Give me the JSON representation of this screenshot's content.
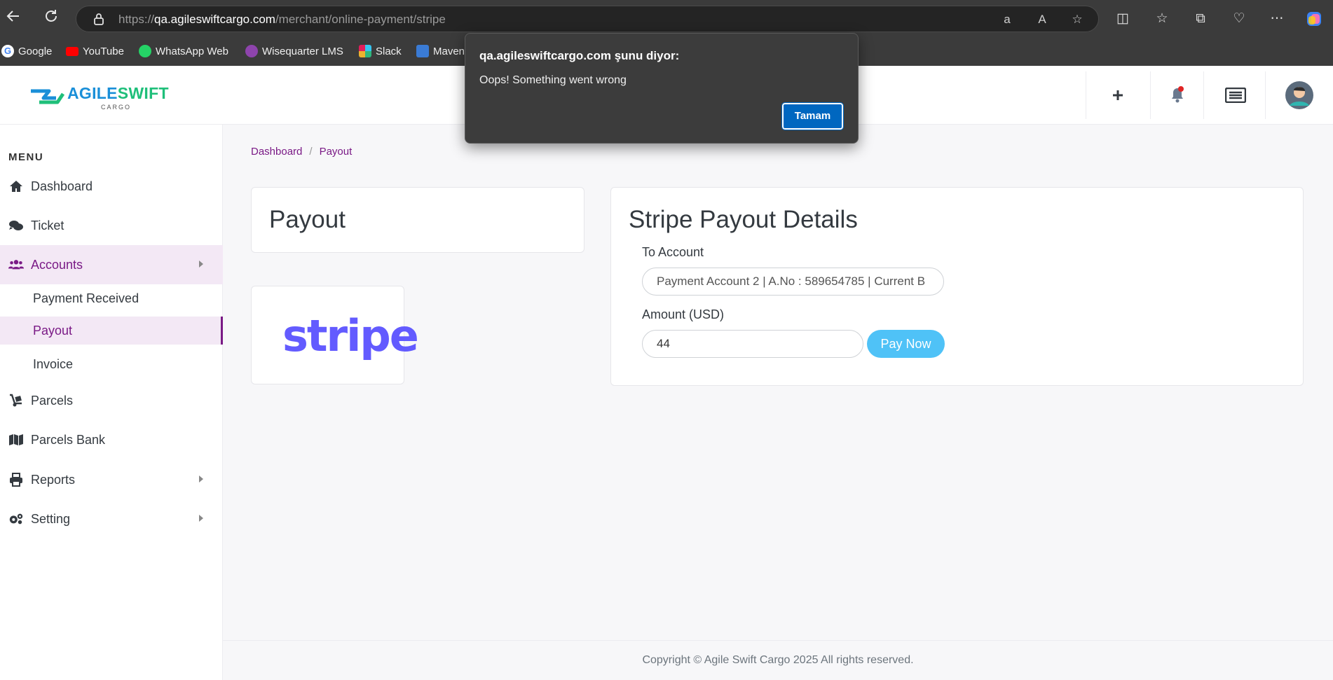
{
  "browser": {
    "url_prefix": "https://",
    "url_host": "qa.agileswiftcargo.com",
    "url_path": "/merchant/online-payment/stripe",
    "bookmarks": [
      {
        "label": "Google",
        "icon": "google-icon",
        "color": "#4285f4"
      },
      {
        "label": "YouTube",
        "icon": "youtube-icon",
        "color": "#ff0000"
      },
      {
        "label": "WhatsApp Web",
        "icon": "whatsapp-icon",
        "color": "#25d366"
      },
      {
        "label": "Wisequarter LMS",
        "icon": "wisequarter-icon",
        "color": "#8e44ad"
      },
      {
        "label": "Slack",
        "icon": "slack-icon",
        "color": "#e01e5a"
      },
      {
        "label": "Maven",
        "icon": "maven-icon",
        "color": "#3a7bd5"
      }
    ]
  },
  "app": {
    "logo_text_a": "AGILE",
    "logo_text_b": "SWIFT",
    "logo_sub": "CARGO",
    "accent": "#7a1a86"
  },
  "sidebar": {
    "menu_title": "MENU",
    "items": [
      {
        "label": "Dashboard",
        "icon": "home-icon"
      },
      {
        "label": "Ticket",
        "icon": "comments-icon"
      },
      {
        "label": "Accounts",
        "icon": "users-icon"
      },
      {
        "label": "Parcels",
        "icon": "dolly-icon"
      },
      {
        "label": "Parcels Bank",
        "icon": "map-icon"
      },
      {
        "label": "Reports",
        "icon": "print-icon"
      },
      {
        "label": "Setting",
        "icon": "cogs-icon"
      }
    ],
    "accounts_sub": [
      "Payment Received",
      "Payout",
      "Invoice"
    ]
  },
  "breadcrumb": {
    "home": "Dashboard",
    "sep": "/",
    "current": "Payout"
  },
  "payout_title": "Payout",
  "stripe_logo": "stripe",
  "details": {
    "title": "Stripe Payout Details",
    "to_account_label": "To Account",
    "to_account_value": "Payment Account 2 | A.No : 589654785 | Current B",
    "amount_label": "Amount (USD)",
    "amount_value": "44",
    "pay_button": "Pay Now"
  },
  "footer": "Copyright © Agile Swift Cargo 2025 All rights reserved.",
  "dialog": {
    "title": "qa.agileswiftcargo.com şunu diyor:",
    "message": "Oops! Something went wrong",
    "ok_label": "Tamam"
  }
}
